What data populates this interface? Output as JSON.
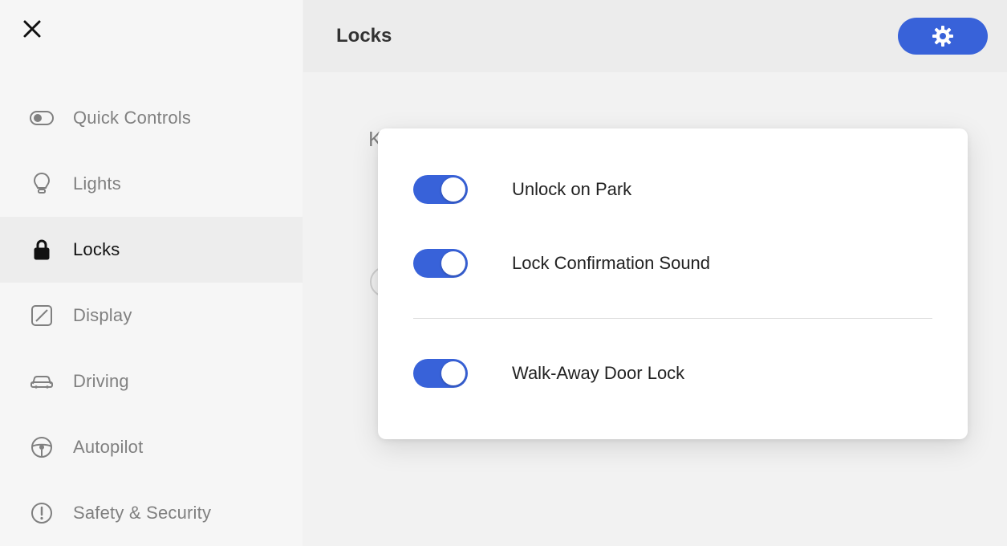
{
  "header": {
    "title": "Locks"
  },
  "sidebar": {
    "items": [
      {
        "label": "Quick Controls",
        "icon": "quick-controls-icon"
      },
      {
        "label": "Lights",
        "icon": "bulb-icon"
      },
      {
        "label": "Locks",
        "icon": "lock-icon"
      },
      {
        "label": "Display",
        "icon": "display-icon"
      },
      {
        "label": "Driving",
        "icon": "car-icon"
      },
      {
        "label": "Autopilot",
        "icon": "steering-icon"
      },
      {
        "label": "Safety & Security",
        "icon": "alert-icon"
      }
    ],
    "active_index": 2
  },
  "background_hint": "K",
  "popover": {
    "toggles": [
      {
        "label": "Unlock on Park",
        "on": true
      },
      {
        "label": "Lock Confirmation Sound",
        "on": true
      },
      {
        "label": "Walk-Away Door Lock",
        "on": true
      }
    ]
  },
  "colors": {
    "accent": "#3862d9"
  }
}
